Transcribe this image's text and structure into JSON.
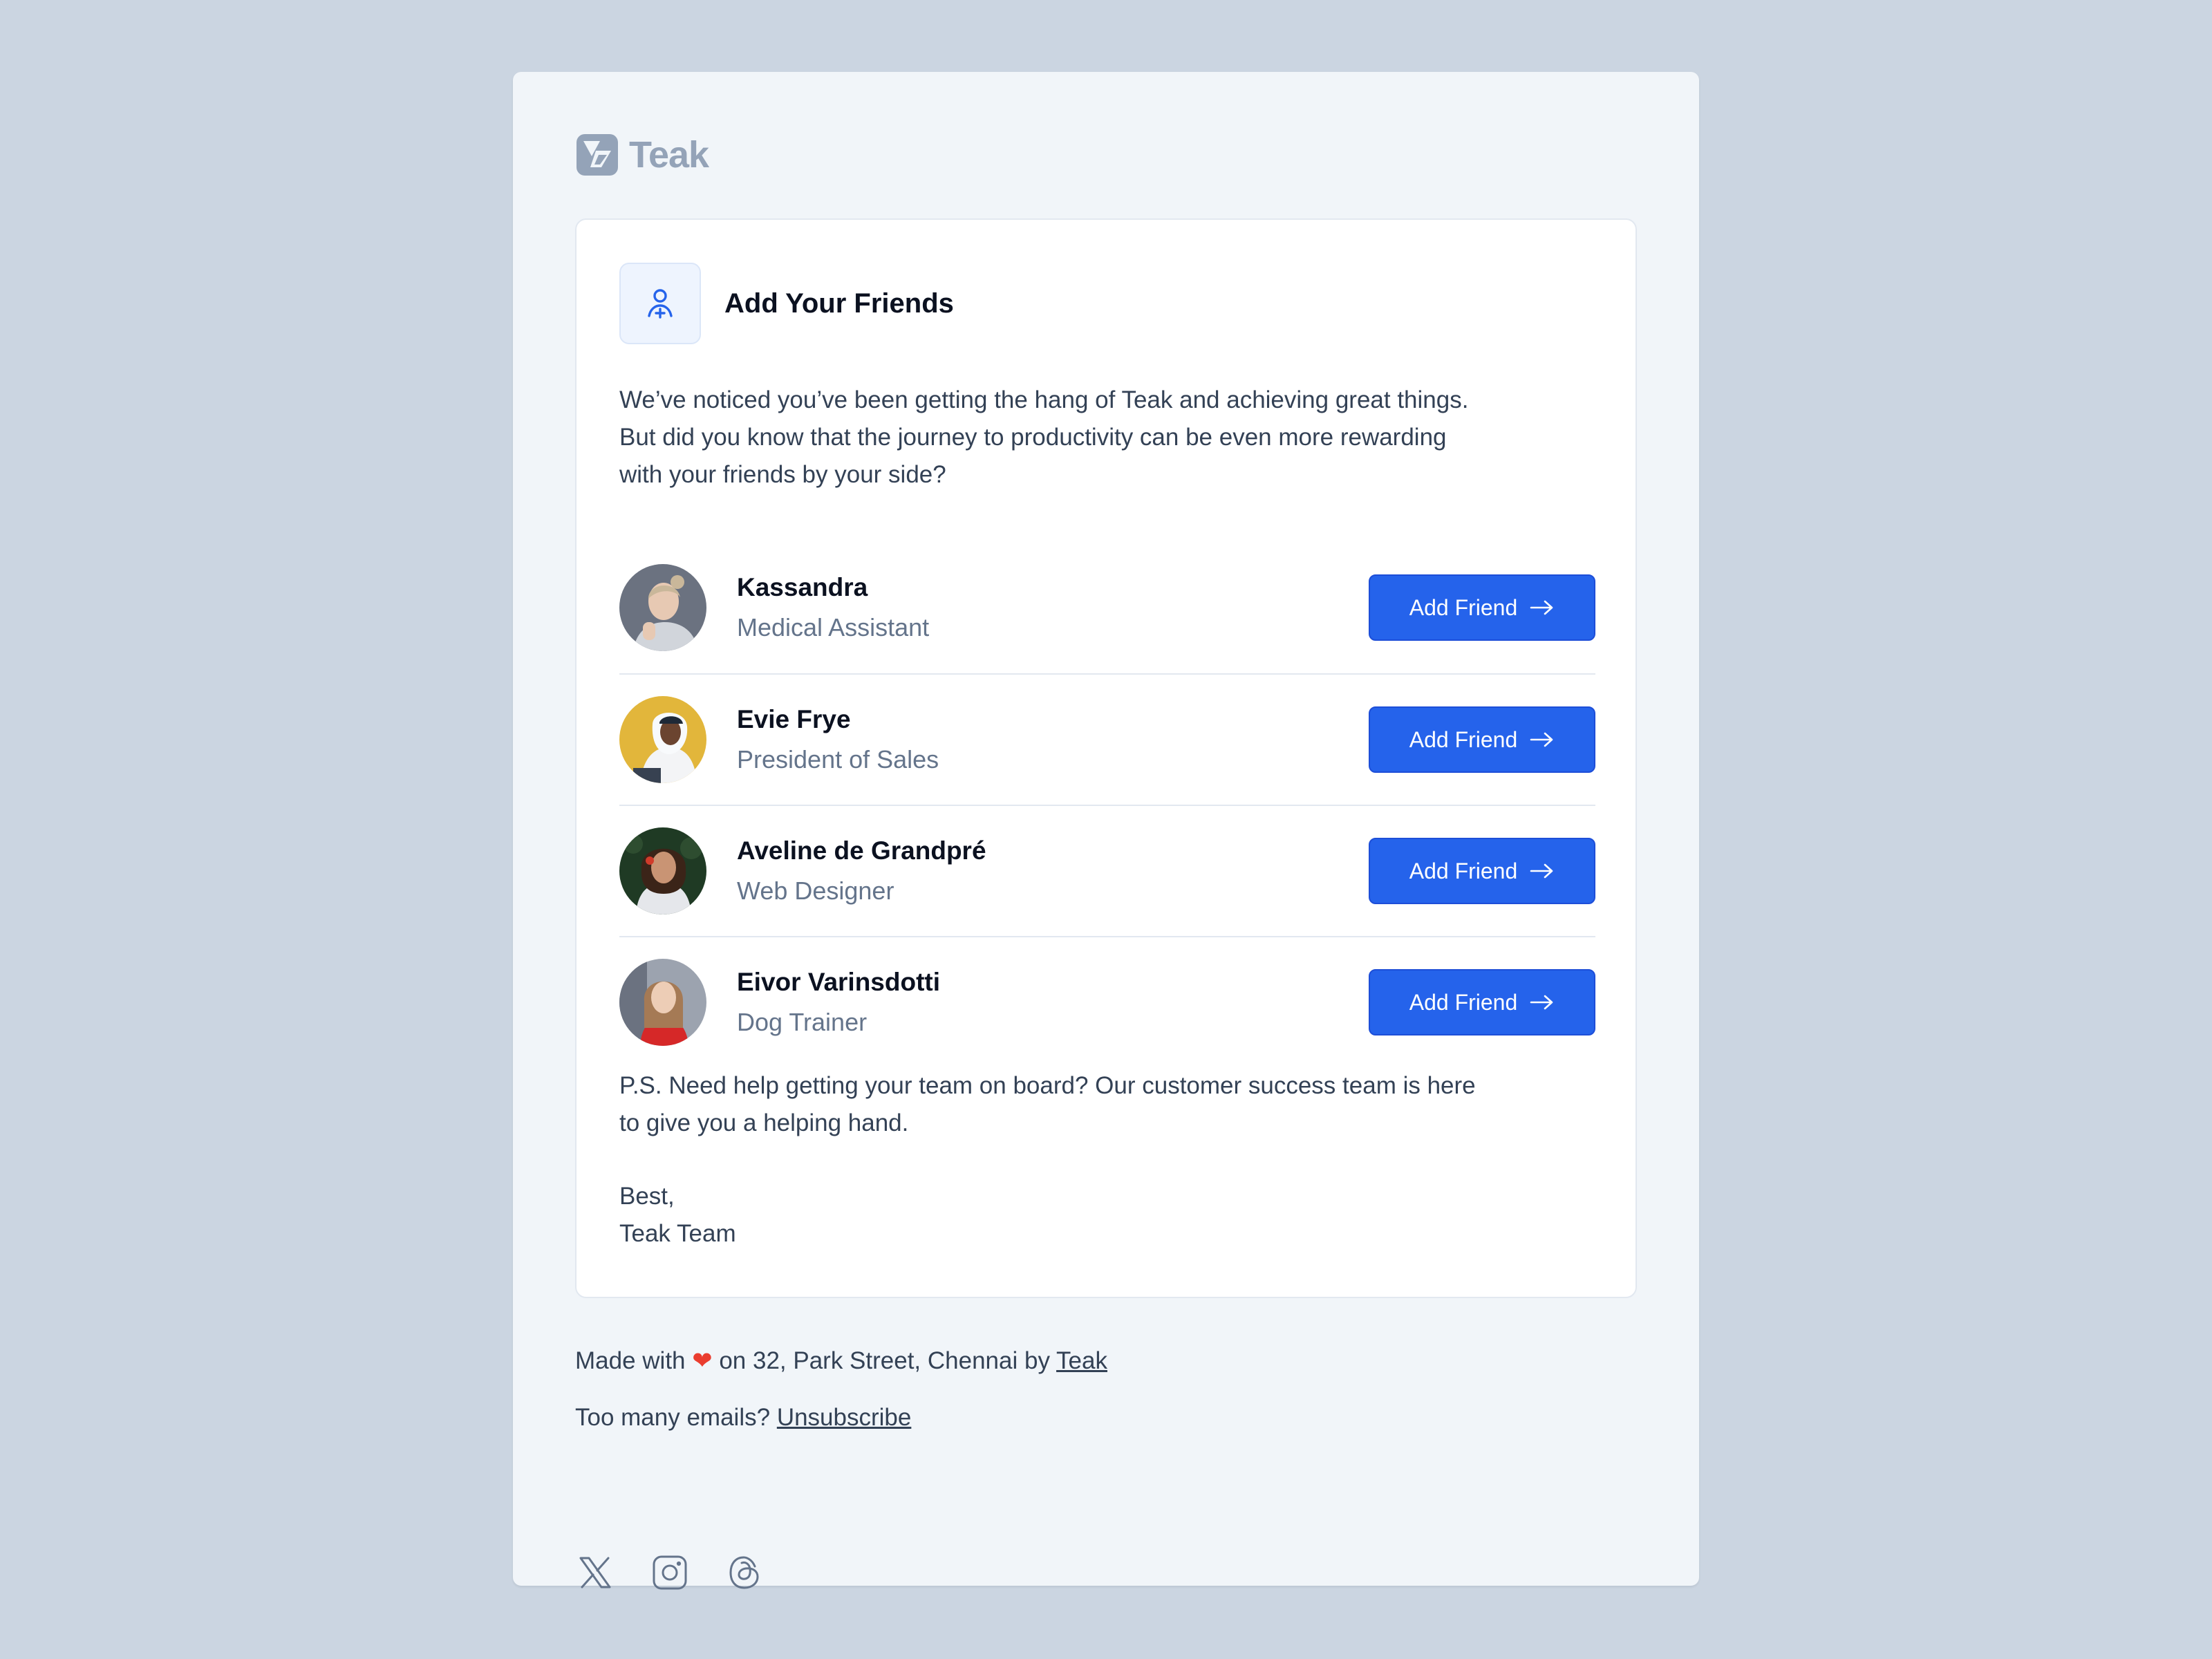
{
  "brand": {
    "name": "Teak",
    "logo_color": "#94a3b8"
  },
  "card": {
    "icon": "user-plus-icon",
    "title": "Add Your Friends",
    "intro_line1": "We’ve noticed you’ve been getting the hang of Teak and achieving great things.",
    "intro_line2": "But did you know that the journey to productivity can be even more rewarding",
    "intro_line3": "with your friends by your side?"
  },
  "friends": [
    {
      "name": "Kassandra",
      "role": "Medical Assistant",
      "button_label": "Add Friend"
    },
    {
      "name": "Evie Frye",
      "role": "President of Sales",
      "button_label": "Add Friend"
    },
    {
      "name": "Aveline de Grandpré",
      "role": "Web Designer",
      "button_label": "Add Friend"
    },
    {
      "name": "Eivor Varinsdotti",
      "role": "Dog Trainer",
      "button_label": "Add Friend"
    }
  ],
  "ps": {
    "line1": "P.S. Need help getting your team on board? Our customer success team is here",
    "line2": "to give you a helping hand."
  },
  "signoff": {
    "closing": "Best,",
    "team": "Teak Team"
  },
  "footer": {
    "made_with_prefix": "Made with",
    "heart": "❤",
    "made_with_suffix": "on 32, Park Street, Chennai by",
    "brand_link": "Teak",
    "unsubscribe_prefix": "Too many emails?",
    "unsubscribe_link": "Unsubscribe",
    "socials": [
      "x-icon",
      "instagram-icon",
      "threads-icon"
    ]
  },
  "colors": {
    "accent": "#2563eb",
    "background": "#cbd5e1",
    "email_background": "#f1f5f9",
    "text": "#334155",
    "muted": "#64748b"
  }
}
